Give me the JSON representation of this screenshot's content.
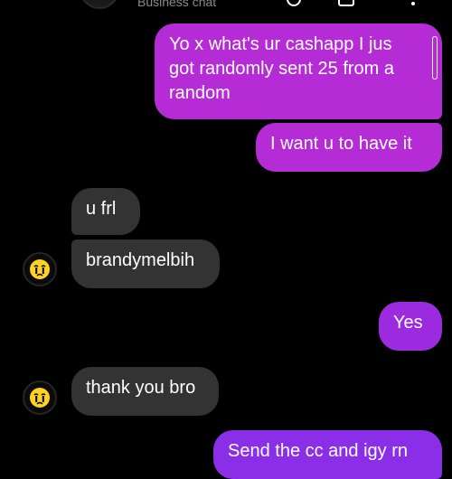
{
  "header": {
    "subtitle": "Business chat"
  },
  "messages": [
    {
      "side": "outgoing",
      "text_lines": [
        "Yo x what's ur cashapp I jus",
        "got randomly sent 25 from a",
        "random"
      ]
    },
    {
      "side": "outgoing",
      "text": "I want u to have it"
    },
    {
      "side": "incoming",
      "text": "u frl"
    },
    {
      "side": "incoming",
      "text": "brandymelbih"
    },
    {
      "side": "outgoing",
      "text": "Yes"
    },
    {
      "side": "incoming",
      "text": "thank you bro"
    },
    {
      "side": "outgoing",
      "text": "Send the cc and igy rn"
    }
  ],
  "colors": {
    "background": "#000000",
    "outgoing_bubble_top": "#b52cd6",
    "outgoing_bubble_bottom": "#8b2ee8",
    "incoming_bubble": "#333333",
    "text": "#ffffff"
  },
  "icons": [
    "crying-face-avatar-icon",
    "phone-icon",
    "video-icon",
    "menu-dots-icon"
  ]
}
